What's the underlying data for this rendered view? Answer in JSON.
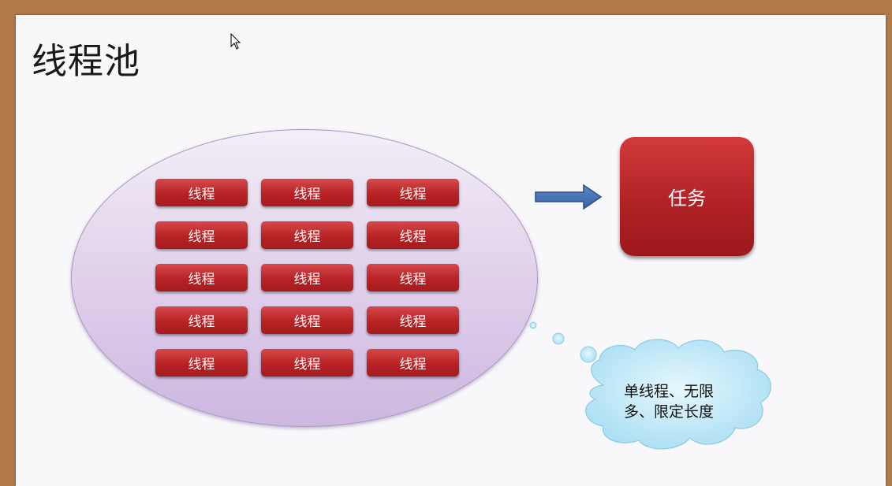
{
  "slide": {
    "title": "线程池",
    "pool": {
      "threads": [
        "线程",
        "线程",
        "线程",
        "线程",
        "线程",
        "线程",
        "线程",
        "线程",
        "线程",
        "线程",
        "线程",
        "线程",
        "线程",
        "线程",
        "线程"
      ]
    },
    "task_label": "任务",
    "cloud": {
      "line1": "单线程、无限",
      "line2": "多、限定长度"
    },
    "colors": {
      "thread_red": "#b82225",
      "pool_purple": "#d8c6e6",
      "arrow_blue": "#4a74b5",
      "cloud_blue": "#c2e9f8"
    }
  }
}
